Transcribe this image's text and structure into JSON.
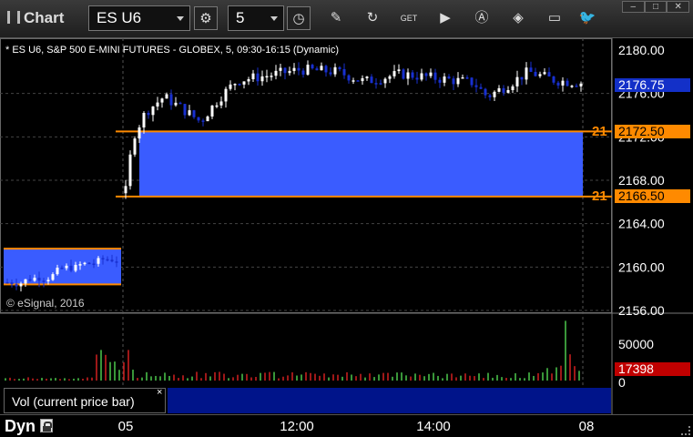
{
  "window": {
    "title": "Chart",
    "symbol": "ES U6",
    "interval": "5",
    "toolbar_icons": [
      "gear-icon",
      "clock-icon",
      "pencil-icon",
      "refresh-icon",
      "get-icon",
      "play-icon",
      "alert-icon",
      "tag-icon",
      "chat-icon",
      "twitter-icon"
    ],
    "window_controls": [
      "minimize",
      "maximize",
      "close"
    ]
  },
  "chart": {
    "status": "* ES U6, S&P 500 E-MINI FUTURES - GLOBEX, 5, 09:30-16:15 (Dynamic)",
    "copyright": "© eSignal, 2016",
    "price_axis_labels": [
      "2180.00",
      "2176.00",
      "2172.00",
      "2168.00",
      "2164.00",
      "2160.00",
      "2156.00"
    ],
    "current_price": "2176.75",
    "zone_top_price": "2172.50",
    "zone_bottom_price": "2166.50",
    "zone_edge_labels": [
      "21",
      "21"
    ],
    "colors": {
      "zone_fill": "#3a5cff",
      "zone_line": "#ff8a00",
      "up_bar": "#ffffff",
      "down_bar": "#1830d0",
      "price_tag": "#1330c8",
      "volume_up": "#4cc94c",
      "volume_down": "#d32020",
      "volume_tag": "#c00000"
    }
  },
  "volume": {
    "axis_labels": [
      "50000",
      "0"
    ],
    "current_value": "17398",
    "indicator_label": "Vol (current price bar)",
    "close_symbol": "×"
  },
  "bottom": {
    "mode": "Dyn",
    "time_labels": [
      "05",
      "12:00",
      "14:00",
      "08"
    ]
  },
  "chart_data": {
    "type": "candlestick",
    "price_range": [
      2155,
      2182
    ],
    "prior_session_zone": [
      2158.4,
      2161.7
    ],
    "zone": [
      2166.5,
      2172.5
    ],
    "current": 2176.75,
    "volume_range": [
      0,
      70000
    ],
    "volume_last": 17398
  }
}
